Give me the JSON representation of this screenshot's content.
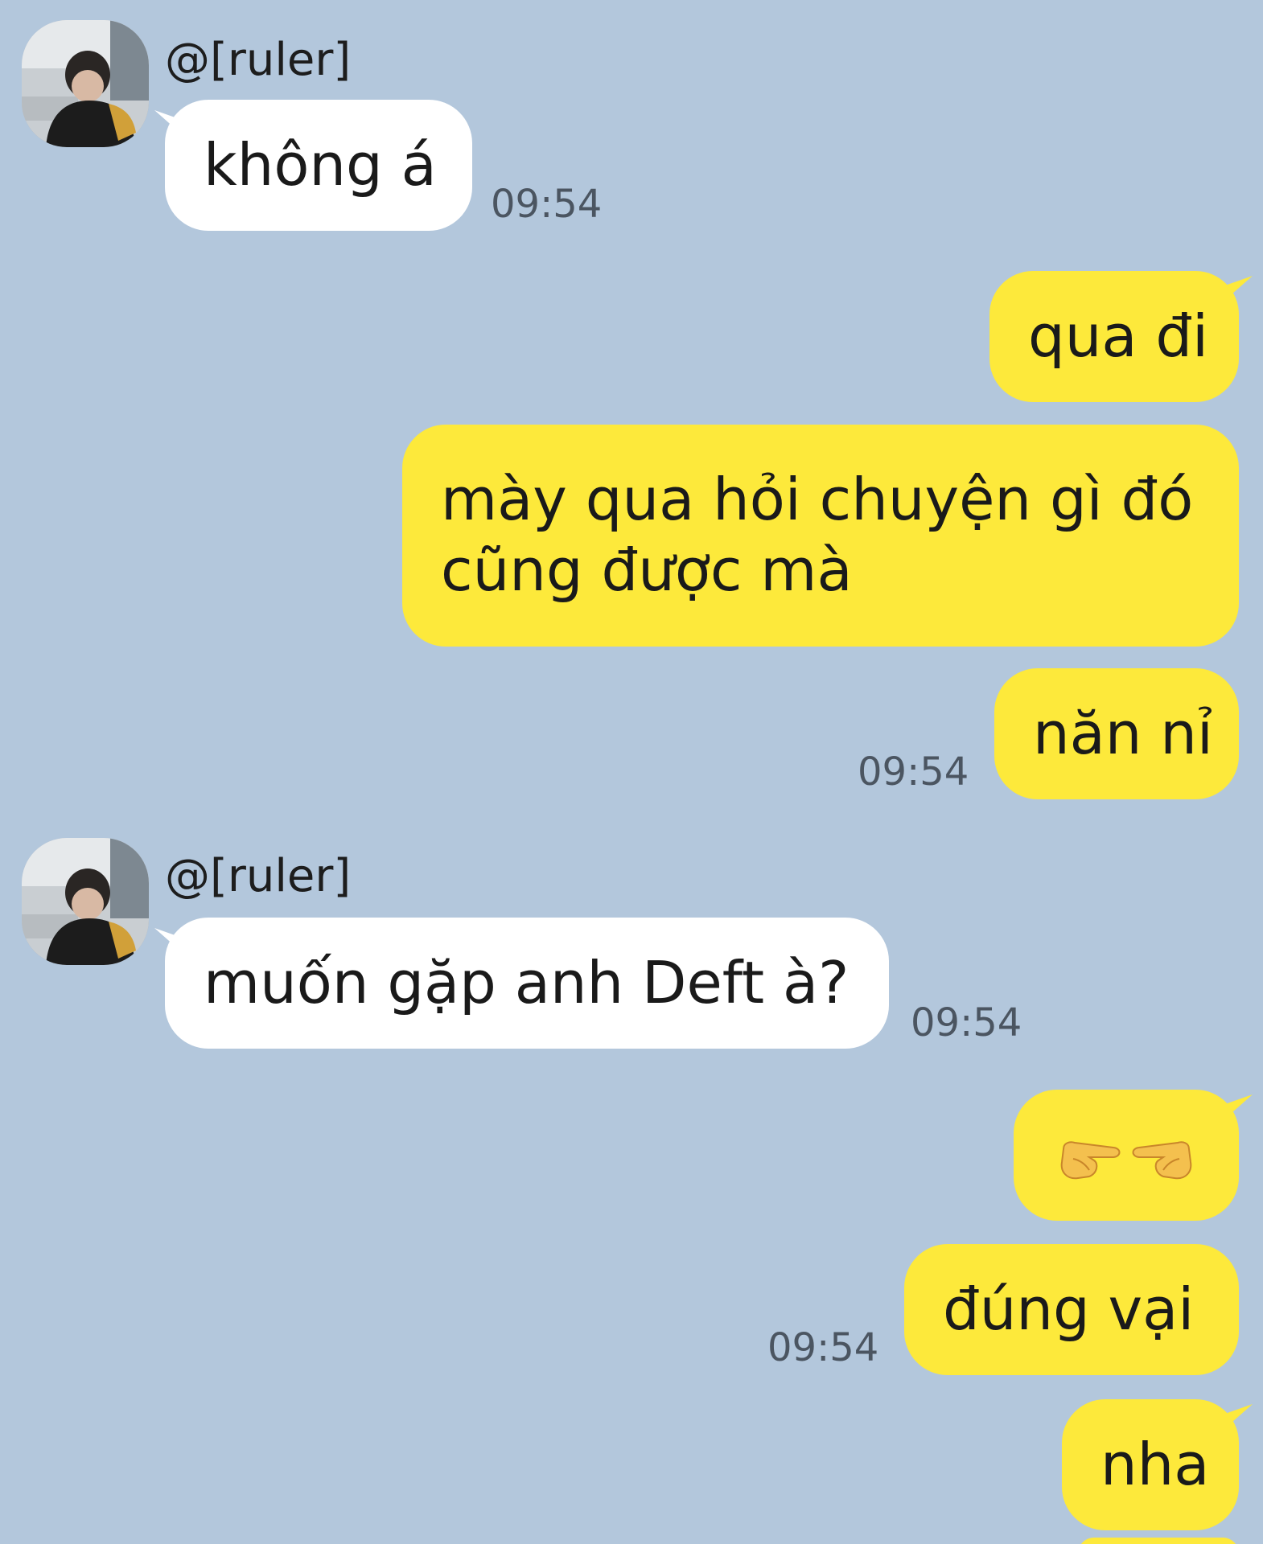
{
  "colors": {
    "background": "#b3c7dc",
    "incoming_bubble": "#ffffff",
    "outgoing_bubble": "#fde93b",
    "timestamp": "#4b5561"
  },
  "messages": [
    {
      "direction": "incoming",
      "sender": "@[ruler]",
      "text": "không á",
      "time": "09:54"
    },
    {
      "direction": "outgoing",
      "text": "qua đi"
    },
    {
      "direction": "outgoing",
      "text": "mày qua hỏi chuyện gì đó cũng được mà"
    },
    {
      "direction": "outgoing",
      "text": "năn nỉ",
      "time": "09:54"
    },
    {
      "direction": "incoming",
      "sender": "@[ruler]",
      "text": "muốn gặp anh Deft à?",
      "time": "09:54"
    },
    {
      "direction": "outgoing",
      "text": "👉👈",
      "icons": [
        "pointing-right-hand-icon",
        "pointing-left-hand-icon"
      ]
    },
    {
      "direction": "outgoing",
      "text": "đúng vại",
      "time": "09:54"
    },
    {
      "direction": "outgoing",
      "text": "nha"
    }
  ]
}
